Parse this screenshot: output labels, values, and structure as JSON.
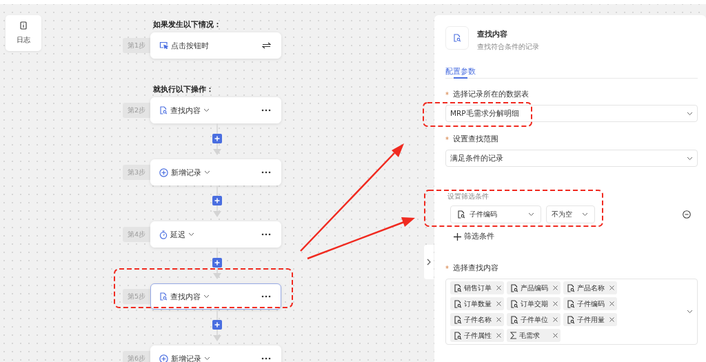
{
  "log_button": {
    "label": "日志"
  },
  "flow": {
    "sections": [
      {
        "heading": "如果发生以下情况：",
        "steps": [
          {
            "step": "第1步",
            "kind": "trigger",
            "label": "点击按钮时",
            "selected": false
          }
        ]
      },
      {
        "heading": "就执行以下操作：",
        "steps": [
          {
            "step": "第2步",
            "kind": "find",
            "label": "查找内容",
            "selected": false
          },
          {
            "step": "第3步",
            "kind": "add",
            "label": "新增记录",
            "selected": false
          },
          {
            "step": "第4步",
            "kind": "delay",
            "label": "延迟",
            "selected": false
          },
          {
            "step": "第5步",
            "kind": "find",
            "label": "查找内容",
            "selected": true
          },
          {
            "step": "第6步",
            "kind": "add",
            "label": "新增记录",
            "selected": false
          }
        ]
      }
    ]
  },
  "panel": {
    "title": "查找内容",
    "subtitle": "查找符合条件的记录",
    "tabs": [
      {
        "label": "配置参数",
        "selected": true
      }
    ],
    "fields": [
      {
        "kind": "select",
        "label": "选择记录所在的数据表",
        "required_mark": "*",
        "value": "MRP毛需求分解明细"
      },
      {
        "kind": "select",
        "label": "设置查找范围",
        "required_mark": "*",
        "value": "满足条件的记录"
      },
      {
        "kind": "filter",
        "label": "设置筛选条件",
        "field": "子件编码",
        "operator": "不为空",
        "add_label": "筛选条件"
      },
      {
        "kind": "tags",
        "label": "选择查找内容",
        "required_mark": "*",
        "tags": [
          {
            "label": "销售订单",
            "kind": "field"
          },
          {
            "label": "产品编码",
            "kind": "field"
          },
          {
            "label": "产品名称",
            "kind": "field"
          },
          {
            "label": "订单数量",
            "kind": "field"
          },
          {
            "label": "订单交期",
            "kind": "field"
          },
          {
            "label": "子件编码",
            "kind": "field"
          },
          {
            "label": "子件名称",
            "kind": "field"
          },
          {
            "label": "子件单位",
            "kind": "field"
          },
          {
            "label": "子件用量",
            "kind": "field"
          },
          {
            "label": "子件属性",
            "kind": "field"
          },
          {
            "label": "毛需求",
            "kind": "formula"
          }
        ]
      }
    ]
  }
}
